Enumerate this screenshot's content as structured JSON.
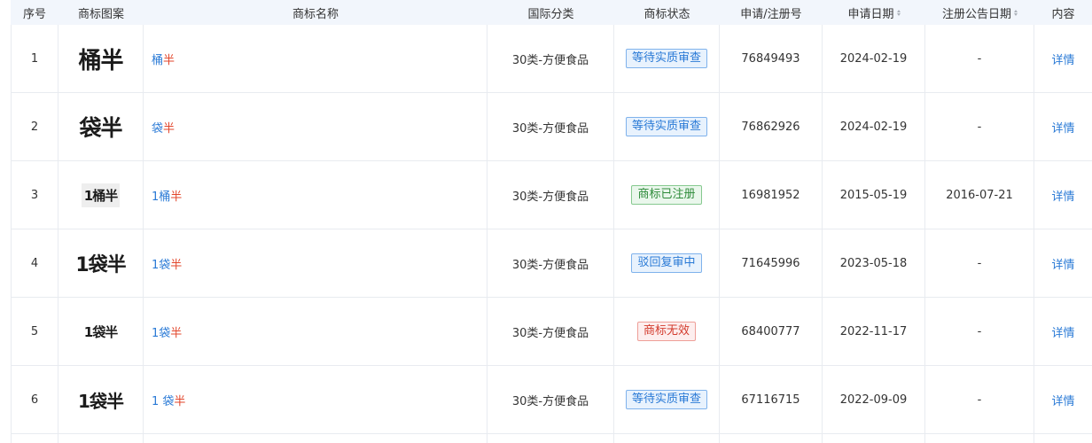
{
  "columns": {
    "index": "序号",
    "image": "商标图案",
    "name": "商标名称",
    "class": "国际分类",
    "status": "商标状态",
    "reg_no": "申请/注册号",
    "apply_date": "申请日期",
    "notice_date": "注册公告日期",
    "content": "内容"
  },
  "rows": [
    {
      "index": "1",
      "logo": "桶半",
      "name_blue": "桶",
      "name_red": "半",
      "class": "30类-方便食品",
      "status": "等待实质审查",
      "status_color": "blue",
      "reg_no": "76849493",
      "apply_date": "2024-02-19",
      "notice_date": "-",
      "content": "详情"
    },
    {
      "index": "2",
      "logo": "袋半",
      "name_blue": "袋",
      "name_red": "半",
      "class": "30类-方便食品",
      "status": "等待实质审查",
      "status_color": "blue",
      "reg_no": "76862926",
      "apply_date": "2024-02-19",
      "notice_date": "-",
      "content": "详情"
    },
    {
      "index": "3",
      "logo": "1桶半",
      "name_blue": "1桶",
      "name_red": "半",
      "class": "30类-方便食品",
      "status": "商标已注册",
      "status_color": "green",
      "reg_no": "16981952",
      "apply_date": "2015-05-19",
      "notice_date": "2016-07-21",
      "content": "详情"
    },
    {
      "index": "4",
      "logo": "1袋半",
      "name_blue": "1袋",
      "name_red": "半",
      "class": "30类-方便食品",
      "status": "驳回复审中",
      "status_color": "blue",
      "reg_no": "71645996",
      "apply_date": "2023-05-18",
      "notice_date": "-",
      "content": "详情"
    },
    {
      "index": "5",
      "logo": "1袋半",
      "name_blue": "1袋",
      "name_red": "半",
      "class": "30类-方便食品",
      "status": "商标无效",
      "status_color": "red",
      "reg_no": "68400777",
      "apply_date": "2022-11-17",
      "notice_date": "-",
      "content": "详情"
    },
    {
      "index": "6",
      "logo": "1袋半",
      "name_blue": "1 袋",
      "name_red": "半",
      "class": "30类-方便食品",
      "status": "等待实质审查",
      "status_color": "blue",
      "reg_no": "67116715",
      "apply_date": "2022-09-09",
      "notice_date": "-",
      "content": "详情"
    }
  ],
  "colors": {
    "link_blue": "#2a7ad6",
    "highlight_red": "#e2462b",
    "header_bg": "#f2f6fc"
  }
}
